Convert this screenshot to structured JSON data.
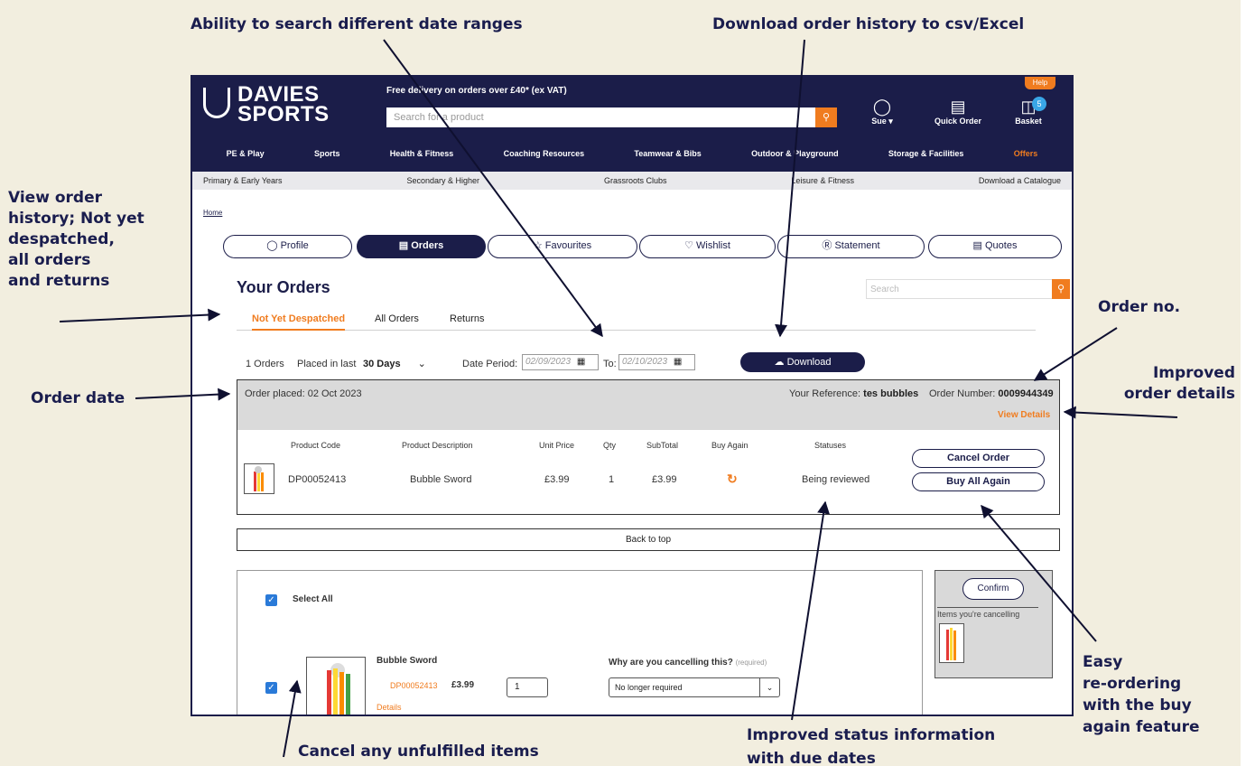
{
  "callouts": {
    "date_ranges": "Ability to search different date ranges",
    "download": "Download order history to csv/Excel",
    "view_history": [
      "View order",
      "history; Not yet",
      "despatched,",
      "all orders",
      "and returns"
    ],
    "order_date": "Order date",
    "order_no": "Order no.",
    "improved_details": [
      "Improved",
      "order details"
    ],
    "easy_reorder": [
      "Easy",
      "re-ordering",
      "with the buy",
      "again feature"
    ],
    "cancel_items": "Cancel any unfulfilled items",
    "status_info": [
      "Improved status information",
      "with due dates"
    ]
  },
  "header": {
    "logo_line1": "DAVIES",
    "logo_line2": "SPORTS",
    "promo": "Free delivery on orders over £40* (ex VAT)",
    "search_placeholder": "Search for a product",
    "help": "Help",
    "user": "Sue ▾",
    "quick_order": "Quick Order",
    "basket": "Basket",
    "basket_count": "5"
  },
  "nav_main": [
    "PE & Play",
    "Sports",
    "Health & Fitness",
    "Coaching Resources",
    "Teamwear & Bibs",
    "Outdoor & Playground",
    "Storage & Facilities",
    "Offers"
  ],
  "nav_sub": [
    "Primary & Early Years",
    "Secondary & Higher",
    "Grassroots Clubs",
    "Leisure & Fitness",
    "Download a Catalogue"
  ],
  "breadcrumb": "Home",
  "account_tabs": [
    "Profile",
    "Orders",
    "Favourites",
    "Wishlist",
    "Statement",
    "Quotes"
  ],
  "orders": {
    "title": "Your Orders",
    "search_placeholder": "Search",
    "subtabs": [
      "Not Yet Despatched",
      "All Orders",
      "Returns"
    ],
    "count": "1 Orders",
    "placed_label": "Placed in last",
    "placed_value": "30 Days",
    "date_period_label": "Date Period:",
    "date_from": "02/09/2023",
    "to_label": "To:",
    "date_to": "02/10/2023",
    "download_label": "Download"
  },
  "order": {
    "placed": "Order placed: 02 Oct 2023",
    "ref_label": "Your Reference:",
    "ref_value": "tes bubbles",
    "num_label": "Order Number:",
    "num_value": "0009944349",
    "view_details": "View Details",
    "columns": [
      "Product Code",
      "Product Description",
      "Unit Price",
      "Qty",
      "SubTotal",
      "Buy Again",
      "Statuses"
    ],
    "row": {
      "code": "DP00052413",
      "description": "Bubble Sword",
      "unit_price": "£3.99",
      "qty": "1",
      "subtotal": "£3.99",
      "status": "Being reviewed"
    },
    "cancel_label": "Cancel Order",
    "buy_all_label": "Buy All Again"
  },
  "back_to_top": "Back to top",
  "cancel": {
    "select_all": "Select All",
    "item_name": "Bubble Sword",
    "item_code": "DP00052413",
    "item_price": "£3.99",
    "item_qty": "1",
    "details": "Details",
    "reason_label": "Why are you cancelling this?",
    "reason_required": "(required)",
    "reason_value": "No longer required",
    "confirm": "Confirm",
    "cancelling_label": "Items you're cancelling"
  },
  "colors": {
    "navy": "#1b1d49",
    "accent": "#f07c1f",
    "background": "#f2eedf"
  }
}
